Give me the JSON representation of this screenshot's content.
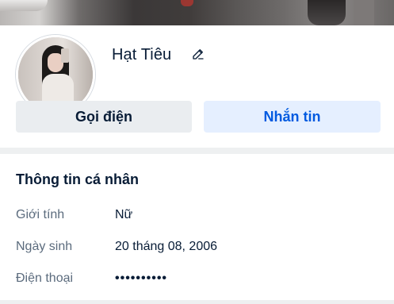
{
  "profile": {
    "name": "Hạt Tiêu",
    "edit_icon": "pencil-icon"
  },
  "actions": {
    "call_label": "Gọi điện",
    "message_label": "Nhắn tin",
    "message_color": "#005ae0"
  },
  "personal_info": {
    "title": "Thông tin cá nhân",
    "rows": [
      {
        "label": "Giới tính",
        "value": "Nữ"
      },
      {
        "label": "Ngày sinh",
        "value": "20 tháng 08, 2006"
      },
      {
        "label": "Điện thoại",
        "value": "••••••••••"
      }
    ]
  }
}
